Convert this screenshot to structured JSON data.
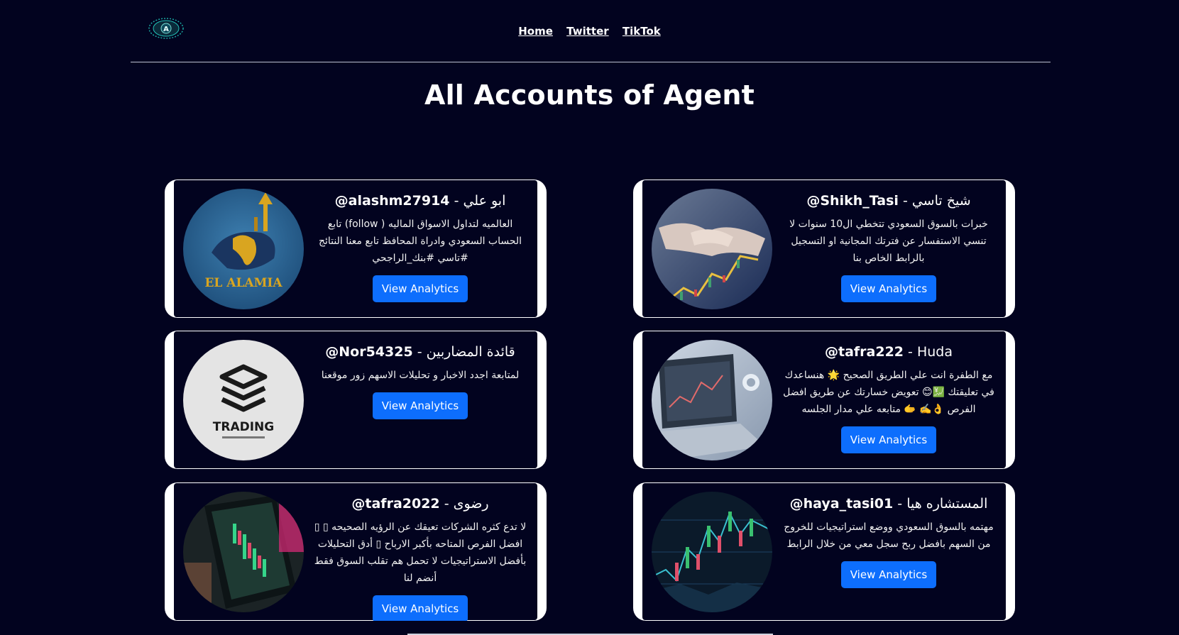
{
  "nav": {
    "home": "Home",
    "twitter": "Twitter",
    "tiktok": "TikTok",
    "logo_text": "A"
  },
  "page": {
    "title": "All Accounts of Agent"
  },
  "accounts": [
    {
      "handle": "@alashm27914",
      "name": "ابو علي",
      "separator": " - ",
      "description": "العالميه لتداول الاسواق الماليه ( follow) تابع الحساب السعودي وادراة المحافظ تابع معنا النتائج #تاسي #بنك_الراجحي",
      "button": "View Analytics",
      "avatar_icon": "el-alamia-logo-avatar"
    },
    {
      "handle": "@Shikh_Tasi",
      "name": "شيخ تاسي",
      "separator": " - ",
      "description": "خبرات بالسوق السعودي تتخطي ال10 سنوات لا تنسي الاستفسار عن فترتك المجانية او التسجيل بالرابط الخاص بنا",
      "button": "View Analytics",
      "avatar_icon": "handshake-chart-avatar"
    },
    {
      "handle": "@Nor54325",
      "name": "قائدة المضاربين",
      "separator": " - ",
      "description": "لمتابعة اجدد الاخبار و تحليلات الاسهم زور موقعنا",
      "button": "View Analytics",
      "avatar_icon": "trading-logo-avatar"
    },
    {
      "handle": "@tafra222",
      "name": "Huda",
      "separator": " - ",
      "description": "مع الطفرة انت علي الطريق الصحيح 🌟 هنساعدك في تعليقتك 💹😊 تعويض خسارتك عن طريق افضل الفرص 👌✍️ 🫱 متابعه علي مدار الجلسه",
      "button": "View Analytics",
      "avatar_icon": "laptop-chart-avatar"
    },
    {
      "handle": "@tafra2022",
      "name": "رضوى",
      "separator": " - ",
      "description": "لا تدع كثره الشركات تعيقك عن الرؤيه الصحيحه ▯ ▯ افضل الفرص المتاحه بأكبر الارباح ▯ أدق التحليلات بأفضل الاستراتيجيات لا تحمل هم تقلب السوق فقط أنضم لنا",
      "button": "View Analytics",
      "avatar_icon": "phone-chart-avatar"
    },
    {
      "handle": "@haya_tasi01",
      "name": "المستشاره هيا",
      "separator": " - ",
      "description": "مهتمه بالسوق السعودي ووضع استراتيجيات للخروج من السهم بافضل ربح سجل معي من خلال الرابط",
      "button": "View Analytics",
      "avatar_icon": "candlestick-chart-avatar"
    }
  ]
}
